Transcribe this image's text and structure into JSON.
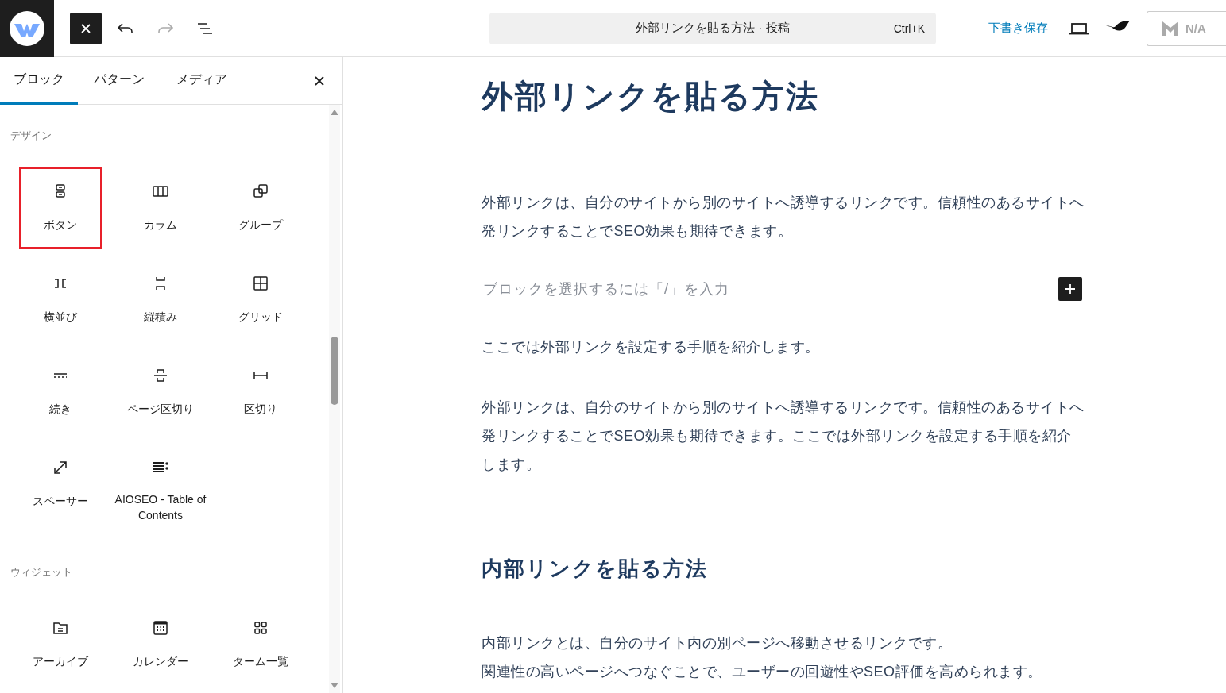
{
  "toolbar": {
    "document_title": "外部リンクを貼る方法 · 投稿",
    "shortcut": "Ctrl+K",
    "save_draft": "下書き保存",
    "seo_score": "N/A"
  },
  "inserter": {
    "tabs": [
      {
        "label": "ブロック",
        "selected": true
      },
      {
        "label": "パターン",
        "selected": false
      },
      {
        "label": "メディア",
        "selected": false
      }
    ],
    "sections": [
      {
        "title": "デザイン",
        "blocks": [
          {
            "label": "ボタン",
            "highlighted": true
          },
          {
            "label": "カラム",
            "highlighted": false
          },
          {
            "label": "グループ",
            "highlighted": false
          },
          {
            "label": "横並び",
            "highlighted": false
          },
          {
            "label": "縦積み",
            "highlighted": false
          },
          {
            "label": "グリッド",
            "highlighted": false
          },
          {
            "label": "続き",
            "highlighted": false
          },
          {
            "label": "ページ区切り",
            "highlighted": false
          },
          {
            "label": "区切り",
            "highlighted": false
          },
          {
            "label": "スペーサー",
            "highlighted": false
          },
          {
            "label": "AIOSEO - Table of Contents",
            "highlighted": false
          }
        ]
      },
      {
        "title": "ウィジェット",
        "blocks": [
          {
            "label": "アーカイブ",
            "highlighted": false
          },
          {
            "label": "カレンダー",
            "highlighted": false
          },
          {
            "label": "ターム一覧",
            "highlighted": false
          }
        ]
      }
    ]
  },
  "editor": {
    "title": "外部リンクを貼る方法",
    "blocks": [
      {
        "kind": "paragraph",
        "lines": [
          "外部リンクは、自分のサイトから別のサイトへ誘導するリンクです。信頼性のあるサイトへ発リンクすることでSEO効果も期待できます。"
        ]
      },
      {
        "kind": "placeholder",
        "placeholder": "ブロックを選択するには「/」を入力"
      },
      {
        "kind": "paragraph",
        "lines": [
          "ここでは外部リンクを設定する手順を紹介します。"
        ]
      },
      {
        "kind": "paragraph",
        "lines": [
          "外部リンクは、自分のサイトから別のサイトへ誘導するリンクです。信頼性のあるサイトへ発リンクすることでSEO効果も期待できます。ここでは外部リンクを設定する手順を紹介します。"
        ]
      },
      {
        "kind": "heading",
        "text": "内部リンクを貼る方法"
      },
      {
        "kind": "paragraph",
        "lines": [
          "内部リンクとは、自分のサイト内の別ページへ移動させるリンクです。",
          "関連性の高いページへつなぐことで、ユーザーの回遊性やSEO評価を高められます。"
        ]
      }
    ]
  }
}
